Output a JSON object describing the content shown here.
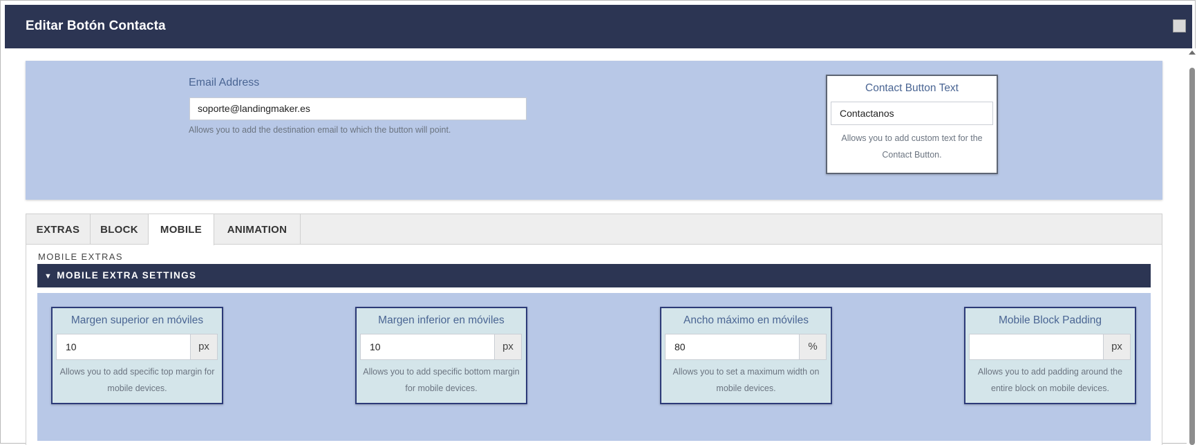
{
  "dialog": {
    "title": "Editar Botón Contacta"
  },
  "email": {
    "label": "Email Address",
    "value": "soporte@landingmaker.es",
    "help": "Allows you to add the destination email to which the button will point."
  },
  "contact_button": {
    "label": "Contact Button Text",
    "value": "Contactanos",
    "help": "Allows you to add custom text for the Contact Button."
  },
  "tabs": [
    {
      "label": "EXTRAS",
      "active": false
    },
    {
      "label": "BLOCK",
      "active": false
    },
    {
      "label": "MOBILE",
      "active": true
    },
    {
      "label": "ANIMATION",
      "active": false
    }
  ],
  "mobile": {
    "section_title": "MOBILE EXTRAS",
    "settings_header": "MOBILE EXTRA SETTINGS",
    "fields": [
      {
        "label": "Margen superior en móviles",
        "value": "10",
        "unit": "px",
        "help": "Allows you to add specific top margin for mobile devices."
      },
      {
        "label": "Margen inferior en móviles",
        "value": "10",
        "unit": "px",
        "help": "Allows you to add specific bottom margin for mobile devices."
      },
      {
        "label": "Ancho máximo en móviles",
        "value": "80",
        "unit": "%",
        "help": "Allows you to set a maximum width on mobile devices."
      },
      {
        "label": "Mobile Block Padding",
        "value": "",
        "unit": "px",
        "help": "Allows you to add padding around the entire block on mobile devices."
      }
    ]
  },
  "colors": {
    "header_bg": "#2c3553",
    "panel_bg": "#b8c8e7",
    "card_bg": "#d4e5ea",
    "card_border": "#2c3a78",
    "label_text": "#4a6593"
  }
}
